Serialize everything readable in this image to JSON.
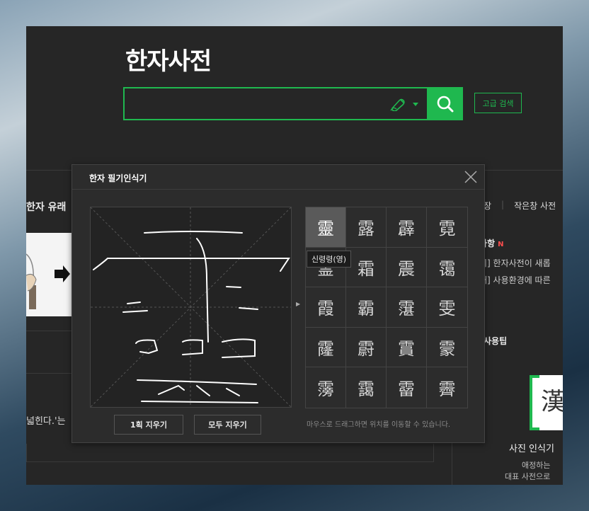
{
  "app": {
    "title": "한자사전"
  },
  "search": {
    "value": "",
    "placeholder": "",
    "advanced_label": "고급 검색"
  },
  "background": {
    "left_heading": "한자 유래",
    "left_text": "넓힌다.'는",
    "right_links": [
      "장",
      "작은창 사전"
    ],
    "notice_heading": "사항",
    "notice_badge": "N",
    "notice_items": [
      "지] 한자사전이 새롭",
      "새] 사용환경에 따른"
    ],
    "tips_heading": "사용팁",
    "photo_title": "사진 인식기",
    "photo_desc1": "애정하는 ",
    "photo_desc2": "대표 사전으로 "
  },
  "dialog": {
    "title": "한자 필기인식기",
    "candidates": [
      "靈",
      "露",
      "霹",
      "霓",
      "霊",
      "霜",
      "震",
      "霭",
      "霞",
      "霸",
      "霮",
      "雯",
      "霳",
      "霨",
      "霣",
      "霥",
      "霶",
      "靄",
      "霤",
      "霽"
    ],
    "selected_index": 0,
    "tooltip": "신령령(영)",
    "erase_one_label": "1획 지우기",
    "erase_all_label": "모두 지우기",
    "hint": "마우스로 드래그하면 위치를 이동할 수 있습니다."
  },
  "colors": {
    "accent": "#1fb84f",
    "background": "#262626",
    "dialog": "#2c2c2c"
  }
}
